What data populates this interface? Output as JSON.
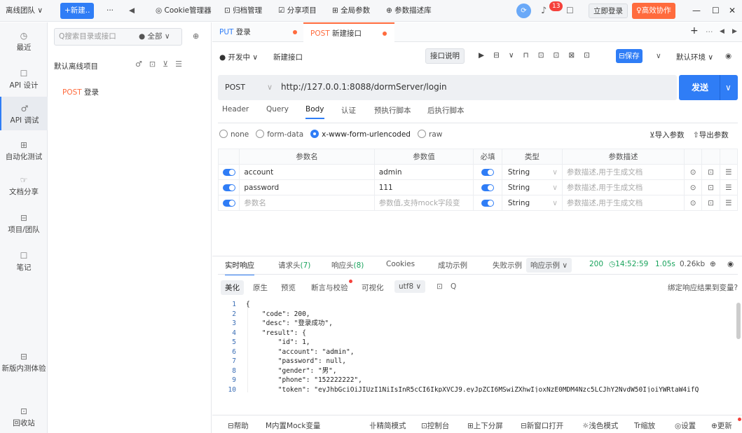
{
  "topbar": {
    "team": "离线团队 ∨",
    "new_btn": "+新建..",
    "more": "···",
    "back": "◀",
    "cookie": "◎ Cookie管理器",
    "archive": "⊡ 归档管理",
    "share": "☑ 分享项目",
    "global_params": "⊞ 全局参数",
    "param_lib": "⊕ 参数描述库",
    "notif_count": "13",
    "login": "立即登录",
    "collab": "♀高效协作",
    "minimize": "—",
    "maximize": "☐",
    "close": "✕"
  },
  "nav": [
    {
      "icon": "◷",
      "label": "最近"
    },
    {
      "icon": "☐",
      "label": "API 设计"
    },
    {
      "icon": "♂",
      "label": "API 调试"
    },
    {
      "icon": "⊞",
      "label": "自动化测试"
    },
    {
      "icon": "☞",
      "label": "文档分享"
    },
    {
      "icon": "⊟",
      "label": "项目/团队"
    },
    {
      "icon": "☐",
      "label": "笔记"
    },
    {
      "icon": "⊟",
      "label": "新版内测体验"
    },
    {
      "icon": "⊡",
      "label": "回收站"
    }
  ],
  "tree": {
    "search_placeholder": "Q搜索目录或接口",
    "filter": "● 全部 ∨",
    "project": "默认离线项目",
    "item_method": "POST",
    "item_name": "登录"
  },
  "tabs": [
    {
      "method": "PUT",
      "name": "登录"
    },
    {
      "method": "POST",
      "name": "新建接口"
    }
  ],
  "request": {
    "env": "● 开发中 ∨",
    "name": "新建接口",
    "doc_btn": "接口说明",
    "save": "⊟保存",
    "default_env": "默认环境 ∨",
    "method": "POST",
    "url": "http://127.0.0.1:8088/dormServer/login",
    "send": "发送"
  },
  "subtabs": [
    "Header",
    "Query",
    "Body",
    "认证",
    "预执行脚本",
    "后执行脚本"
  ],
  "body_types": [
    "none",
    "form-data",
    "x-www-form-urlencoded",
    "raw"
  ],
  "import": "⊻导入参数",
  "export": "⇧导出参数",
  "table": {
    "headers": [
      "参数名",
      "参数值",
      "必填",
      "类型",
      "参数描述"
    ],
    "rows": [
      {
        "name": "account",
        "value": "admin",
        "type": "String",
        "desc": "参数描述,用于生成文档"
      },
      {
        "name": "password",
        "value": "111",
        "type": "String",
        "desc": "参数描述,用于生成文档"
      },
      {
        "name": "参数名",
        "value": "参数值,支持mock字段变",
        "type": "String",
        "desc": "参数描述,用于生成文档"
      }
    ]
  },
  "response": {
    "tabs": [
      "实时响应",
      "请求头(7)",
      "响应头(8)",
      "Cookies",
      "成功示例",
      "失败示例"
    ],
    "example": "响应示例 ∨",
    "status": "200",
    "time": "◷14:52:59",
    "duration": "1.05s",
    "size": "0.26kb",
    "views": [
      "美化",
      "原生",
      "预览",
      "断言与校验",
      "可视化"
    ],
    "encoding": "utf8 ∨",
    "bind": "绑定响应结果到变量?"
  },
  "code_lines": [
    "{",
    "    \"code\": 200,",
    "    \"desc\": \"登录成功\",",
    "    \"result\": {",
    "        \"id\": 1,",
    "        \"account\": \"admin\",",
    "        \"password\": null,",
    "        \"gender\": \"男\",",
    "        \"phone\": \"152222222\",",
    "        \"token\": \"eyJhbGciOiJIUzI1NiIsInR5cCI6IkpXVCJ9.eyJpZCI6MSwiZXhwIjoxNzE0MDM4Nzc5LCJhY2NvdW50IjoiYWRtaW4ifQ"
  ],
  "bottom": [
    "⊟帮助",
    "M内置Mock变量",
    "卝精简模式",
    "⊡控制台",
    "⊞上下分屏",
    "⊟新窗口打开",
    "☼浅色模式",
    "Tr缩放",
    "◎设置",
    "⊕更新"
  ]
}
